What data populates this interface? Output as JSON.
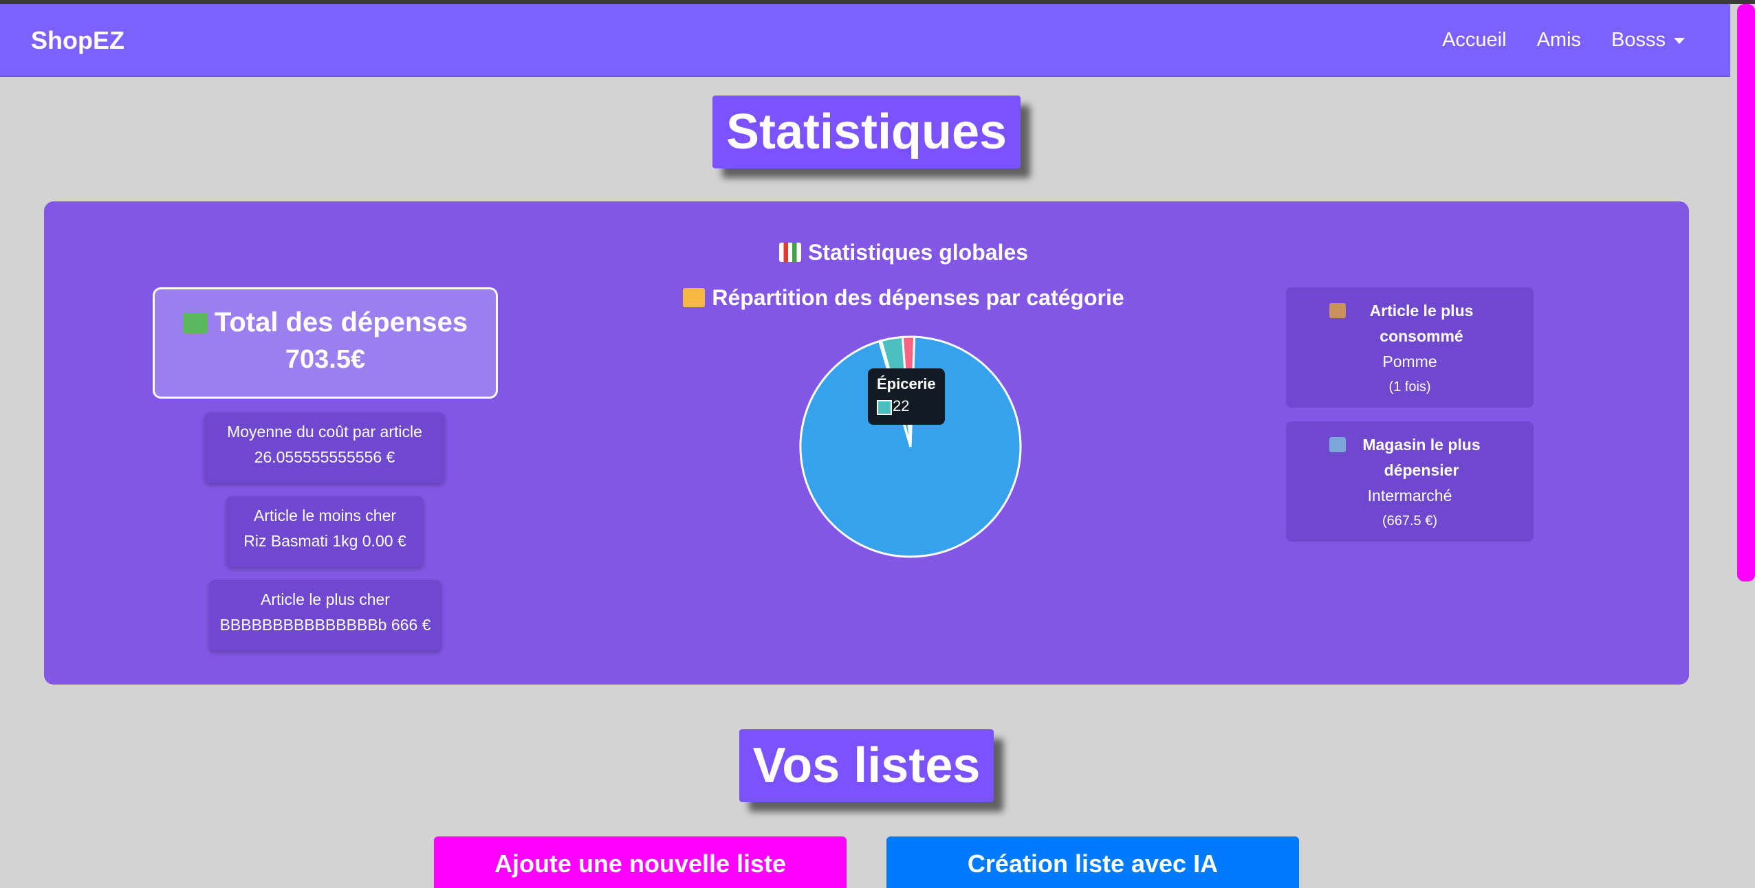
{
  "navbar": {
    "brand": "ShopEZ",
    "links": [
      "Accueil",
      "Amis"
    ],
    "user_menu": "Bosss"
  },
  "stats_section": {
    "title": "Statistiques",
    "global_title": "Statistiques globales",
    "global_icon": "bar-chart-emoji",
    "total": {
      "icon": "money-wings-emoji",
      "label": "Total des dépenses",
      "value": "703.5€"
    },
    "average": {
      "label": "Moyenne du coût par article",
      "value": "26.055555555556 €"
    },
    "cheapest": {
      "label": "Article le moins cher",
      "value": "Riz Basmati 1kg 0.00 €"
    },
    "most_expensive": {
      "label": "Article le plus cher",
      "value": "BBBBBBBBBBBBBBBb 666 €"
    },
    "most_consumed": {
      "icon": "package-emoji",
      "label": "Article le plus consommé",
      "value": "Pomme",
      "sub": "(1 fois)"
    },
    "top_store": {
      "icon": "convenience-store-emoji",
      "label": "Magasin le plus dépensier",
      "value": "Intermarché",
      "sub": "(667.5 €)"
    }
  },
  "chart_data": {
    "type": "pie",
    "title": "Répartition des dépenses par catégorie",
    "title_icon": "folder-emoji",
    "categories": [
      "",
      "Épicerie",
      "",
      ""
    ],
    "values": [
      667.5,
      22,
      2,
      12
    ],
    "colors": [
      "#36a2eb",
      "#4bc0c0",
      "#c9cbcf",
      "#ff6384"
    ],
    "tooltip": {
      "label": "Épicerie",
      "value": "22"
    }
  },
  "lists_section": {
    "title": "Vos listes",
    "add_button": "Ajoute une nouvelle liste",
    "ai_button": "Création liste avec IA"
  },
  "colors": {
    "navbar": "#7b61ff",
    "panel": "#8257e5",
    "card": "#7048d0",
    "accent_pink": "#ff00ff",
    "accent_blue": "#007bff"
  }
}
